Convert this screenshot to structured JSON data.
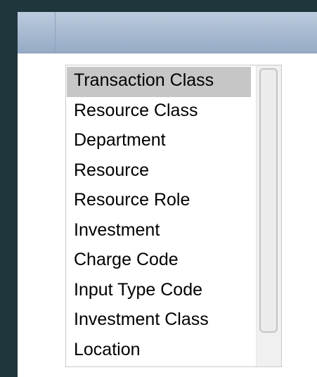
{
  "listbox": {
    "items": [
      {
        "label": "Transaction Class",
        "selected": true
      },
      {
        "label": "Resource Class",
        "selected": false
      },
      {
        "label": "Department",
        "selected": false
      },
      {
        "label": "Resource",
        "selected": false
      },
      {
        "label": "Resource Role",
        "selected": false
      },
      {
        "label": "Investment",
        "selected": false
      },
      {
        "label": "Charge Code",
        "selected": false
      },
      {
        "label": "Input Type Code",
        "selected": false
      },
      {
        "label": "Investment Class",
        "selected": false
      },
      {
        "label": "Location",
        "selected": false
      }
    ]
  },
  "colors": {
    "background": "#1f363c",
    "header": "#a8bad1",
    "selected_item": "#c6c6c6"
  }
}
